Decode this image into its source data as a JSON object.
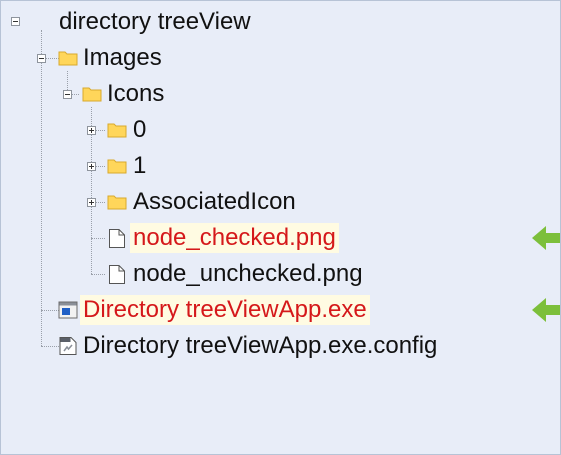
{
  "tree": {
    "root": {
      "label": "directory treeView"
    },
    "images": {
      "label": "Images"
    },
    "icons": {
      "label": "Icons"
    },
    "folder_0": {
      "label": "0"
    },
    "folder_1": {
      "label": "1"
    },
    "associated_icon": {
      "label": "AssociatedIcon"
    },
    "node_checked": {
      "label": "node_checked.png"
    },
    "node_unchecked": {
      "label": "node_unchecked.png"
    },
    "exe": {
      "label": "Directory treeViewApp.exe"
    },
    "config": {
      "label": "Directory treeViewApp.exe.config"
    }
  },
  "colors": {
    "background": "#e8edf8",
    "folder": "#ffd65a",
    "highlight_text": "#d5181a",
    "highlight_bg": "#fffbe2",
    "arrow": "#7cbf3b"
  },
  "icons": {
    "folder": "folder-icon",
    "file": "file-icon",
    "exe": "application-icon",
    "config": "config-file-icon",
    "arrow": "arrow-left-icon"
  }
}
